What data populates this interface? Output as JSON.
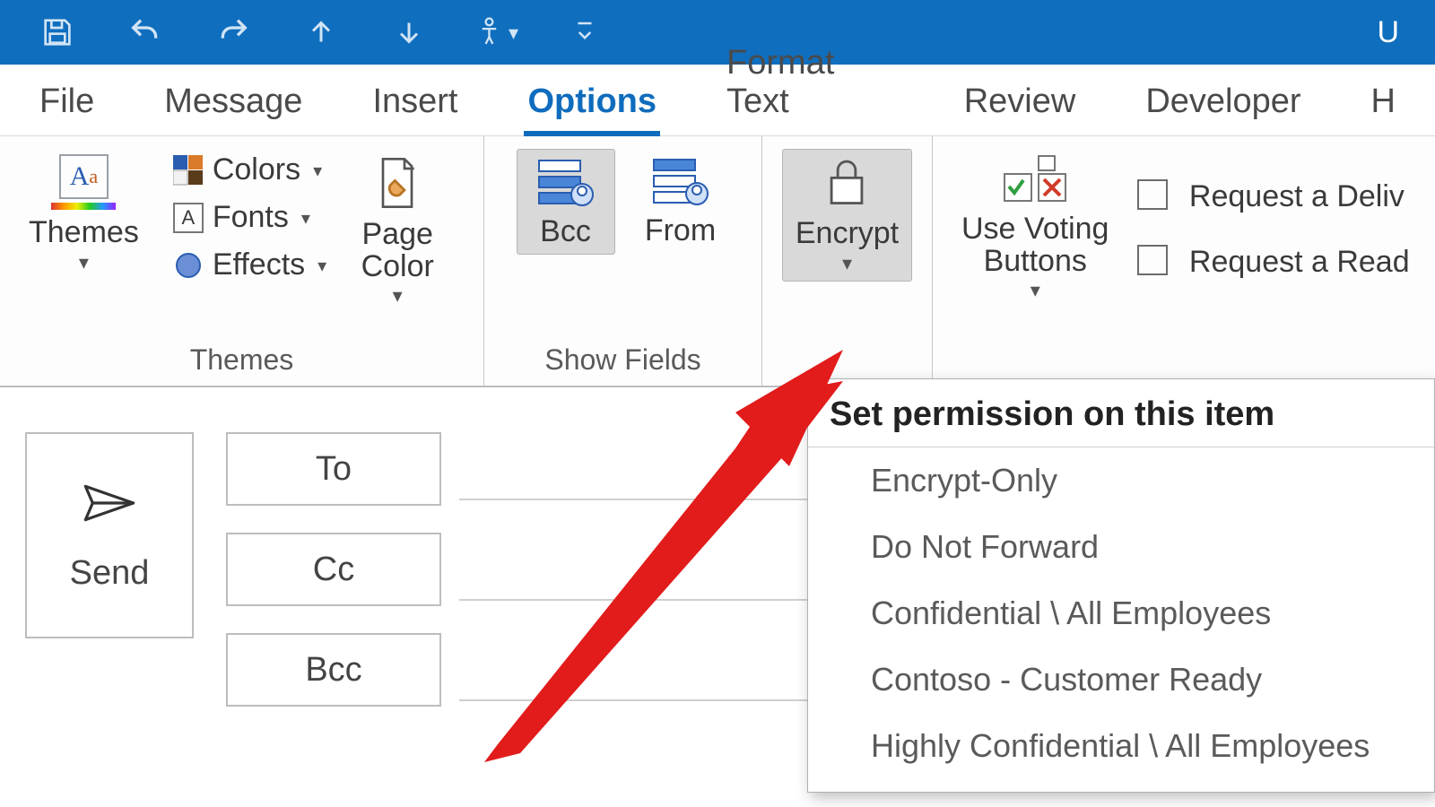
{
  "titlebar": {
    "right_text": "U"
  },
  "tabs": {
    "items": [
      {
        "label": "File"
      },
      {
        "label": "Message"
      },
      {
        "label": "Insert"
      },
      {
        "label": "Options"
      },
      {
        "label": "Format Text"
      },
      {
        "label": "Review"
      },
      {
        "label": "Developer"
      },
      {
        "label": "H"
      }
    ],
    "active_index": 3
  },
  "ribbon": {
    "themes": {
      "label": "Themes",
      "themes_btn": "Themes",
      "colors": "Colors",
      "fonts": "Fonts",
      "effects": "Effects",
      "page_color": "Page\nColor"
    },
    "show_fields": {
      "label": "Show Fields",
      "bcc": "Bcc",
      "from": "From"
    },
    "encrypt": {
      "label": "Encrypt"
    },
    "voting": {
      "label": "Use Voting\nButtons"
    },
    "tracking": {
      "delivery": "Request a Deliv",
      "read": "Request a Read"
    }
  },
  "compose": {
    "send": "Send",
    "to": "To",
    "cc": "Cc",
    "bcc": "Bcc"
  },
  "popup": {
    "title": "Set permission on this item",
    "items": [
      "Encrypt-Only",
      "Do Not Forward",
      "Confidential \\ All Employees",
      "Contoso - Customer Ready",
      "Highly Confidential \\ All Employees"
    ]
  }
}
